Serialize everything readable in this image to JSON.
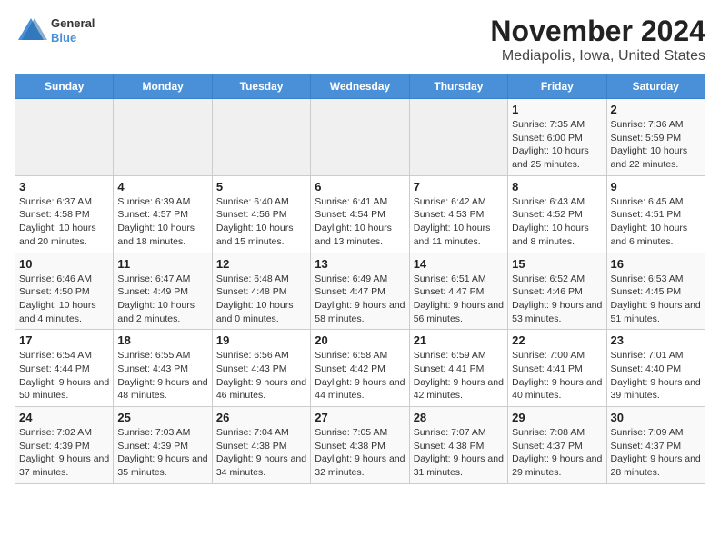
{
  "header": {
    "title": "November 2024",
    "subtitle": "Mediapolis, Iowa, United States",
    "logo_line1": "General",
    "logo_line2": "Blue"
  },
  "weekdays": [
    "Sunday",
    "Monday",
    "Tuesday",
    "Wednesday",
    "Thursday",
    "Friday",
    "Saturday"
  ],
  "weeks": [
    [
      {
        "day": "",
        "info": ""
      },
      {
        "day": "",
        "info": ""
      },
      {
        "day": "",
        "info": ""
      },
      {
        "day": "",
        "info": ""
      },
      {
        "day": "",
        "info": ""
      },
      {
        "day": "1",
        "info": "Sunrise: 7:35 AM\nSunset: 6:00 PM\nDaylight: 10 hours and 25 minutes."
      },
      {
        "day": "2",
        "info": "Sunrise: 7:36 AM\nSunset: 5:59 PM\nDaylight: 10 hours and 22 minutes."
      }
    ],
    [
      {
        "day": "3",
        "info": "Sunrise: 6:37 AM\nSunset: 4:58 PM\nDaylight: 10 hours and 20 minutes."
      },
      {
        "day": "4",
        "info": "Sunrise: 6:39 AM\nSunset: 4:57 PM\nDaylight: 10 hours and 18 minutes."
      },
      {
        "day": "5",
        "info": "Sunrise: 6:40 AM\nSunset: 4:56 PM\nDaylight: 10 hours and 15 minutes."
      },
      {
        "day": "6",
        "info": "Sunrise: 6:41 AM\nSunset: 4:54 PM\nDaylight: 10 hours and 13 minutes."
      },
      {
        "day": "7",
        "info": "Sunrise: 6:42 AM\nSunset: 4:53 PM\nDaylight: 10 hours and 11 minutes."
      },
      {
        "day": "8",
        "info": "Sunrise: 6:43 AM\nSunset: 4:52 PM\nDaylight: 10 hours and 8 minutes."
      },
      {
        "day": "9",
        "info": "Sunrise: 6:45 AM\nSunset: 4:51 PM\nDaylight: 10 hours and 6 minutes."
      }
    ],
    [
      {
        "day": "10",
        "info": "Sunrise: 6:46 AM\nSunset: 4:50 PM\nDaylight: 10 hours and 4 minutes."
      },
      {
        "day": "11",
        "info": "Sunrise: 6:47 AM\nSunset: 4:49 PM\nDaylight: 10 hours and 2 minutes."
      },
      {
        "day": "12",
        "info": "Sunrise: 6:48 AM\nSunset: 4:48 PM\nDaylight: 10 hours and 0 minutes."
      },
      {
        "day": "13",
        "info": "Sunrise: 6:49 AM\nSunset: 4:47 PM\nDaylight: 9 hours and 58 minutes."
      },
      {
        "day": "14",
        "info": "Sunrise: 6:51 AM\nSunset: 4:47 PM\nDaylight: 9 hours and 56 minutes."
      },
      {
        "day": "15",
        "info": "Sunrise: 6:52 AM\nSunset: 4:46 PM\nDaylight: 9 hours and 53 minutes."
      },
      {
        "day": "16",
        "info": "Sunrise: 6:53 AM\nSunset: 4:45 PM\nDaylight: 9 hours and 51 minutes."
      }
    ],
    [
      {
        "day": "17",
        "info": "Sunrise: 6:54 AM\nSunset: 4:44 PM\nDaylight: 9 hours and 50 minutes."
      },
      {
        "day": "18",
        "info": "Sunrise: 6:55 AM\nSunset: 4:43 PM\nDaylight: 9 hours and 48 minutes."
      },
      {
        "day": "19",
        "info": "Sunrise: 6:56 AM\nSunset: 4:43 PM\nDaylight: 9 hours and 46 minutes."
      },
      {
        "day": "20",
        "info": "Sunrise: 6:58 AM\nSunset: 4:42 PM\nDaylight: 9 hours and 44 minutes."
      },
      {
        "day": "21",
        "info": "Sunrise: 6:59 AM\nSunset: 4:41 PM\nDaylight: 9 hours and 42 minutes."
      },
      {
        "day": "22",
        "info": "Sunrise: 7:00 AM\nSunset: 4:41 PM\nDaylight: 9 hours and 40 minutes."
      },
      {
        "day": "23",
        "info": "Sunrise: 7:01 AM\nSunset: 4:40 PM\nDaylight: 9 hours and 39 minutes."
      }
    ],
    [
      {
        "day": "24",
        "info": "Sunrise: 7:02 AM\nSunset: 4:39 PM\nDaylight: 9 hours and 37 minutes."
      },
      {
        "day": "25",
        "info": "Sunrise: 7:03 AM\nSunset: 4:39 PM\nDaylight: 9 hours and 35 minutes."
      },
      {
        "day": "26",
        "info": "Sunrise: 7:04 AM\nSunset: 4:38 PM\nDaylight: 9 hours and 34 minutes."
      },
      {
        "day": "27",
        "info": "Sunrise: 7:05 AM\nSunset: 4:38 PM\nDaylight: 9 hours and 32 minutes."
      },
      {
        "day": "28",
        "info": "Sunrise: 7:07 AM\nSunset: 4:38 PM\nDaylight: 9 hours and 31 minutes."
      },
      {
        "day": "29",
        "info": "Sunrise: 7:08 AM\nSunset: 4:37 PM\nDaylight: 9 hours and 29 minutes."
      },
      {
        "day": "30",
        "info": "Sunrise: 7:09 AM\nSunset: 4:37 PM\nDaylight: 9 hours and 28 minutes."
      }
    ]
  ]
}
